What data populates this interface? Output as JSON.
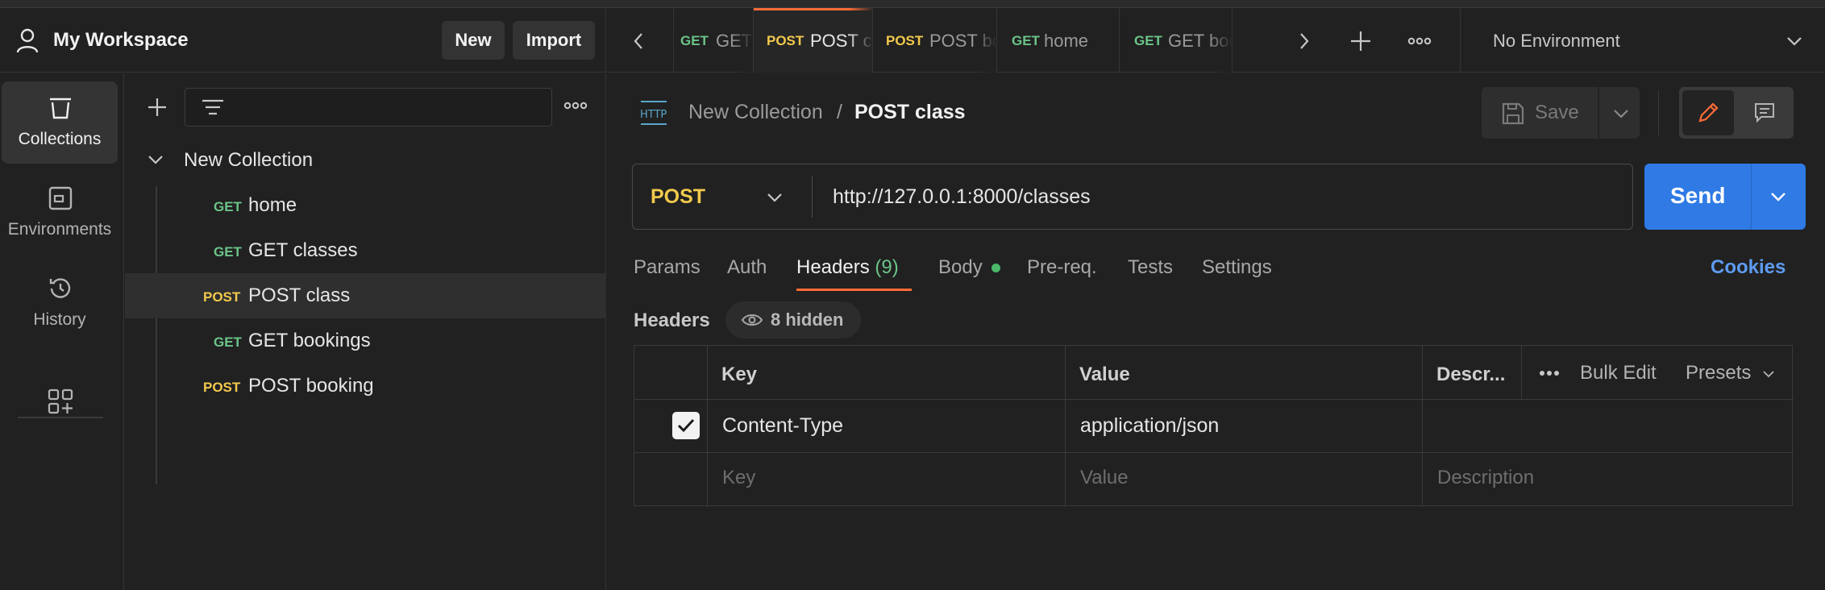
{
  "workspace": {
    "title": "My Workspace",
    "new_label": "New",
    "import_label": "Import"
  },
  "sidebar": {
    "items": [
      {
        "label": "Collections",
        "icon": "collections-icon"
      },
      {
        "label": "Environments",
        "icon": "environments-icon"
      },
      {
        "label": "History",
        "icon": "history-icon"
      }
    ]
  },
  "collection": {
    "name": "New Collection",
    "requests": [
      {
        "method": "GET",
        "name": "home"
      },
      {
        "method": "GET",
        "name": "GET classes"
      },
      {
        "method": "POST",
        "name": "POST class"
      },
      {
        "method": "GET",
        "name": "GET bookings"
      },
      {
        "method": "POST",
        "name": "POST booking"
      }
    ]
  },
  "tabs": [
    {
      "method": "GET",
      "name": "GET classes"
    },
    {
      "method": "POST",
      "name": "POST class"
    },
    {
      "method": "POST",
      "name": "POST booking"
    },
    {
      "method": "GET",
      "name": "home"
    },
    {
      "method": "GET",
      "name": "GET bookings"
    }
  ],
  "environment": {
    "selected": "No Environment"
  },
  "request": {
    "breadcrumb_parent": "New Collection",
    "breadcrumb_sep": "/",
    "breadcrumb_current": "POST class",
    "save_label": "Save",
    "method": "POST",
    "url": "http://127.0.0.1:8000/classes",
    "send_label": "Send"
  },
  "request_tabs": {
    "params": "Params",
    "auth": "Auth",
    "headers": "Headers",
    "headers_count": "(9)",
    "body": "Body",
    "prereq": "Pre-req.",
    "tests": "Tests",
    "settings": "Settings",
    "cookies": "Cookies"
  },
  "headers_section": {
    "title": "Headers",
    "hidden_label": "8 hidden",
    "columns": {
      "key": "Key",
      "value": "Value",
      "description": "Descr...",
      "bulk_edit": "Bulk Edit",
      "presets": "Presets"
    },
    "rows": [
      {
        "checked": true,
        "key": "Content-Type",
        "value": "application/json",
        "description": ""
      }
    ],
    "placeholder": {
      "key": "Key",
      "value": "Value",
      "description": "Description"
    }
  },
  "colors": {
    "accent": "#ff6c37",
    "send": "#2f7ae5",
    "get": "#6bc488",
    "post": "#f2c94c",
    "cookies": "#5d9bf0"
  }
}
